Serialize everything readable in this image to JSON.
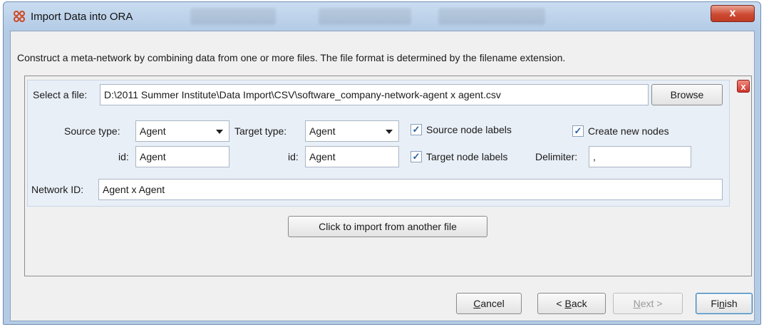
{
  "window": {
    "title": "Import Data into ORA",
    "close_label": "x"
  },
  "description": "Construct a meta-network by combining data from one or more files. The file format is determined by the filename extension.",
  "file": {
    "select_label": "Select a file:",
    "path": "D:\\2011 Summer Institute\\Data Import\\CSV\\software_company-network-agent x agent.csv",
    "browse_label": "Browse",
    "remove_label": "x",
    "source_type_label": "Source type:",
    "source_type_value": "Agent",
    "target_type_label": "Target type:",
    "target_type_value": "Agent",
    "source_id_label": "id:",
    "source_id_value": "Agent",
    "target_id_label": "id:",
    "target_id_value": "Agent",
    "source_node_labels": {
      "label": "Source node labels",
      "checked": true
    },
    "target_node_labels": {
      "label": "Target node labels",
      "checked": true
    },
    "create_new_nodes": {
      "label": "Create new nodes",
      "checked": true
    },
    "delimiter_label": "Delimiter:",
    "delimiter_value": ",",
    "network_id_label": "Network ID:",
    "network_id_value": "Agent x Agent"
  },
  "import_another_label": "Click to import from another file",
  "footer": {
    "cancel": {
      "pre": "",
      "mn": "C",
      "post": "ancel"
    },
    "back": {
      "pre": "< ",
      "mn": "B",
      "post": "ack"
    },
    "next": {
      "pre": "",
      "mn": "N",
      "post": "ext >"
    },
    "finish": {
      "pre": "Fi",
      "mn": "n",
      "post": "ish"
    }
  }
}
